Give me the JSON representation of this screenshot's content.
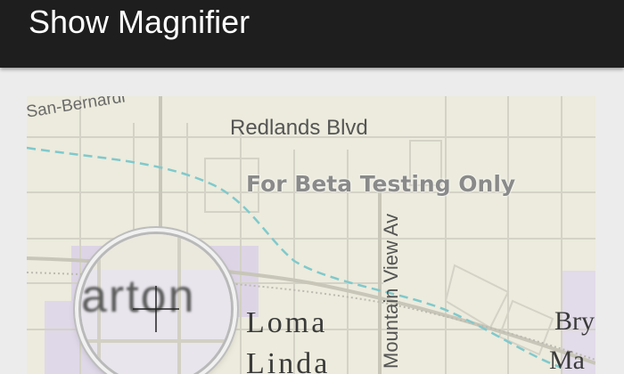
{
  "app_bar": {
    "title": "Show Magnifier"
  },
  "map": {
    "watermark": "For  Beta Testing Only",
    "labels": {
      "san_bernardino": "San-Bernardi",
      "redlands_blvd": "Redlands Blvd",
      "mountain_view": "Mountain View Av",
      "loma_line1": "Loma",
      "loma_line2": "Linda",
      "bry_line1": "Bry",
      "bry_line2": "Ma"
    },
    "magnifier": {
      "magnified_text": "arton"
    }
  },
  "colors": {
    "app_bar": "#1e1e1e",
    "map_background": "#ecebdd",
    "road": "#cfcdc0",
    "water": "#7fc9cc",
    "district": "#dcd3e6"
  }
}
